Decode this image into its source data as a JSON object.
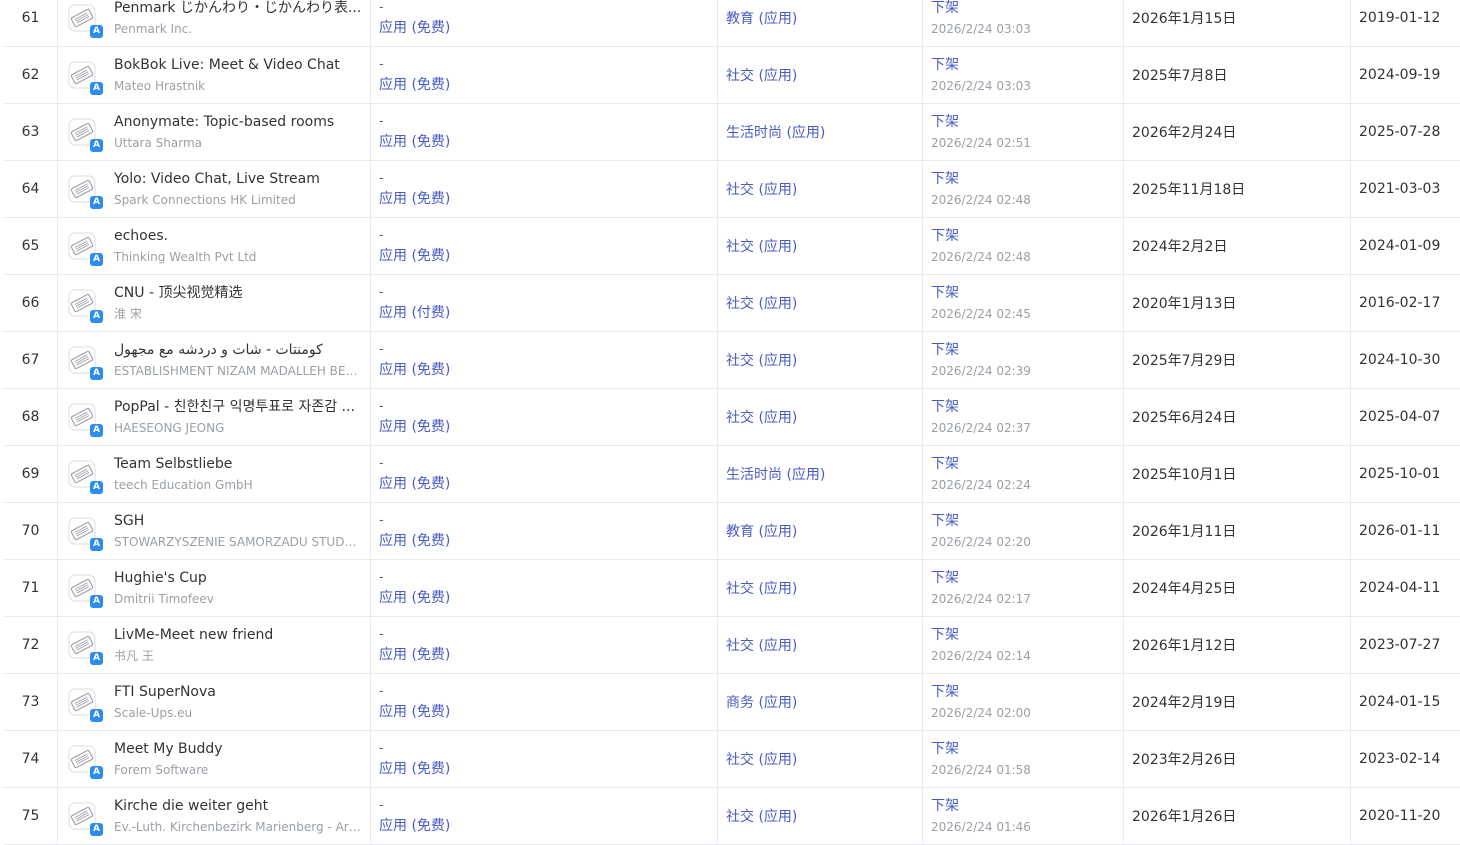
{
  "rows": [
    {
      "rank": "61",
      "name": "Penmark じかんわり・じかんわり表...",
      "developer": "Penmark Inc.",
      "price_dash": "-",
      "price_type": "应用 (免费)",
      "category": "教育 (应用)",
      "status": "下架",
      "status_time": "2026/2/24 03:03",
      "date": "2026年1月15日",
      "release": "2019-01-12"
    },
    {
      "rank": "62",
      "name": "BokBok Live: Meet & Video Chat",
      "developer": "Mateo Hrastnik",
      "price_dash": "-",
      "price_type": "应用 (免费)",
      "category": "社交 (应用)",
      "status": "下架",
      "status_time": "2026/2/24 03:03",
      "date": "2025年7月8日",
      "release": "2024-09-19"
    },
    {
      "rank": "63",
      "name": "Anonymate: Topic-based rooms",
      "developer": "Uttara Sharma",
      "price_dash": "-",
      "price_type": "应用 (免费)",
      "category": "生活时尚 (应用)",
      "status": "下架",
      "status_time": "2026/2/24 02:51",
      "date": "2026年2月24日",
      "release": "2025-07-28"
    },
    {
      "rank": "64",
      "name": "Yolo: Video Chat, Live Stream",
      "developer": "Spark Connections HK Limited",
      "price_dash": "-",
      "price_type": "应用 (免费)",
      "category": "社交 (应用)",
      "status": "下架",
      "status_time": "2026/2/24 02:48",
      "date": "2025年11月18日",
      "release": "2021-03-03"
    },
    {
      "rank": "65",
      "name": "echoes.",
      "developer": "Thinking Wealth Pvt Ltd",
      "price_dash": "-",
      "price_type": "应用 (免费)",
      "category": "社交 (应用)",
      "status": "下架",
      "status_time": "2026/2/24 02:48",
      "date": "2024年2月2日",
      "release": "2024-01-09"
    },
    {
      "rank": "66",
      "name": "CNU - 顶尖视觉精选",
      "developer": "淮 宋",
      "price_dash": "-",
      "price_type": "应用 (付费)",
      "category": "社交 (应用)",
      "status": "下架",
      "status_time": "2026/2/24 02:45",
      "date": "2020年1月13日",
      "release": "2016-02-17"
    },
    {
      "rank": "67",
      "name": "كومنتات - شات و دردشه مع مجهول",
      "developer": "ESTABLISHMENT NIZAM MADALLEH BEDI...",
      "price_dash": "-",
      "price_type": "应用 (免费)",
      "category": "社交 (应用)",
      "status": "下架",
      "status_time": "2026/2/24 02:39",
      "date": "2025年7月29日",
      "release": "2024-10-30"
    },
    {
      "rank": "68",
      "name": "PopPal - 친한친구 익명투표로 자존감 ...",
      "developer": "HAESEONG JEONG",
      "price_dash": "-",
      "price_type": "应用 (免费)",
      "category": "社交 (应用)",
      "status": "下架",
      "status_time": "2026/2/24 02:37",
      "date": "2025年6月24日",
      "release": "2025-04-07"
    },
    {
      "rank": "69",
      "name": "Team Selbstliebe",
      "developer": "teech Education GmbH",
      "price_dash": "-",
      "price_type": "应用 (免费)",
      "category": "生活时尚 (应用)",
      "status": "下架",
      "status_time": "2026/2/24 02:24",
      "date": "2025年10月1日",
      "release": "2025-10-01"
    },
    {
      "rank": "70",
      "name": "SGH",
      "developer": "STOWARZYSZENIE SAMORZADU STUDEN...",
      "price_dash": "-",
      "price_type": "应用 (免费)",
      "category": "教育 (应用)",
      "status": "下架",
      "status_time": "2026/2/24 02:20",
      "date": "2026年1月11日",
      "release": "2026-01-11"
    },
    {
      "rank": "71",
      "name": "Hughie's Cup",
      "developer": "Dmitrii Timofeev",
      "price_dash": "-",
      "price_type": "应用 (免费)",
      "category": "社交 (应用)",
      "status": "下架",
      "status_time": "2026/2/24 02:17",
      "date": "2024年4月25日",
      "release": "2024-04-11"
    },
    {
      "rank": "72",
      "name": "LivMe-Meet new friend",
      "developer": "书凡 王",
      "price_dash": "-",
      "price_type": "应用 (免费)",
      "category": "社交 (应用)",
      "status": "下架",
      "status_time": "2026/2/24 02:14",
      "date": "2026年1月12日",
      "release": "2023-07-27"
    },
    {
      "rank": "73",
      "name": "FTI SuperNova",
      "developer": "Scale-Ups.eu",
      "price_dash": "-",
      "price_type": "应用 (免费)",
      "category": "商务 (应用)",
      "status": "下架",
      "status_time": "2026/2/24 02:00",
      "date": "2024年2月19日",
      "release": "2024-01-15"
    },
    {
      "rank": "74",
      "name": "Meet My Buddy",
      "developer": "Forem Software",
      "price_dash": "-",
      "price_type": "应用 (免费)",
      "category": "社交 (应用)",
      "status": "下架",
      "status_time": "2026/2/24 01:58",
      "date": "2023年2月26日",
      "release": "2023-02-14"
    },
    {
      "rank": "75",
      "name": "Kirche die weiter geht",
      "developer": "Ev.-Luth. Kirchenbezirk Marienberg - Arbeits...",
      "price_dash": "-",
      "price_type": "应用 (免费)",
      "category": "社交 (应用)",
      "status": "下架",
      "status_time": "2026/2/24 01:46",
      "date": "2026年1月26日",
      "release": "2020-11-20"
    }
  ],
  "icons": {
    "app_icon": "removed-app-placeholder-icon",
    "store_badge": "app-store-badge-icon"
  },
  "colors": {
    "link": "#4a5bc4",
    "muted": "#9aa0a6",
    "badge": "#2d8cf0",
    "border": "#e8eaee"
  }
}
